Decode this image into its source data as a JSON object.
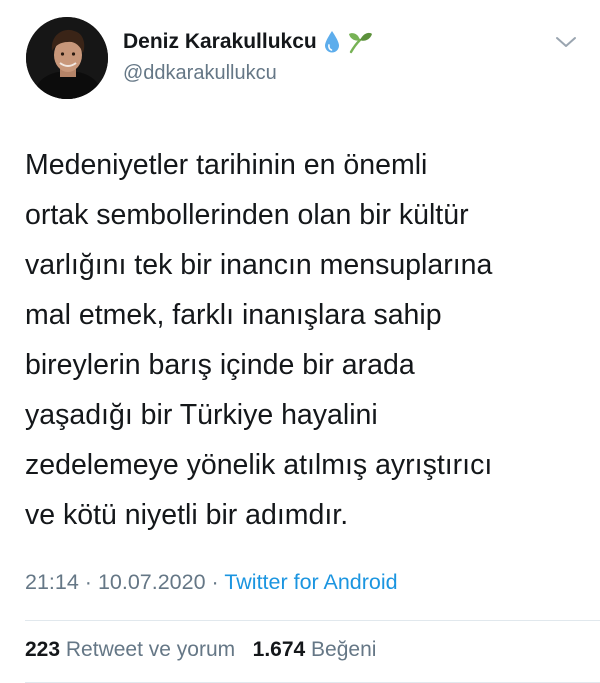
{
  "author": {
    "display_name": "Deniz Karakullukcu",
    "handle": "@ddkarakullukcu",
    "name_emojis": [
      "droplet",
      "seedling"
    ]
  },
  "tweet": {
    "lines": [
      "Medeniyetler tarihinin en önemli",
      "ortak sembollerinden olan bir kültür",
      "varlığını tek bir inancın mensuplarına",
      "mal etmek, farklı inanışlara sahip",
      "bireylerin barış içinde bir arada",
      "yaşadığı bir Türkiye hayalini",
      "zedelemeye yönelik atılmış ayrıştırıcı",
      "ve kötü niyetli bir adımdır."
    ]
  },
  "meta": {
    "time": "21:14",
    "separator": "·",
    "date": "10.07.2020",
    "source": "Twitter for Android"
  },
  "stats": {
    "retweets_count": "223",
    "retweets_label": "Retweet ve yorum",
    "likes_count": "1.674",
    "likes_label": "Beğeni"
  },
  "icons": {
    "menu": "chevron-down-icon"
  },
  "colors": {
    "text": "#14171a",
    "secondary": "#657786",
    "link": "#1b95e0",
    "divider": "#e1e8ed"
  }
}
